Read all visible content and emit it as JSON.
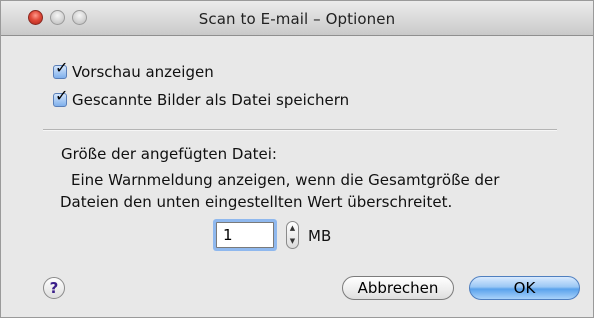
{
  "window": {
    "title": "Scan to E-mail – Optionen"
  },
  "options": {
    "preview": {
      "label": "Vorschau anzeigen",
      "checked": true
    },
    "save_as_file": {
      "label": "Gescannte Bilder als Datei speichern",
      "checked": true
    }
  },
  "attachment": {
    "heading": "Größe der angefügten Datei:",
    "description_line1": "Eine Warnmeldung anzeigen, wenn die Gesamtgröße der",
    "description_line2": "Dateien den unten eingestellten Wert überschreitet.",
    "size_value": "1",
    "unit": "MB"
  },
  "footer": {
    "help_label": "?",
    "cancel_label": "Abbrechen",
    "ok_label": "OK"
  },
  "icons": {
    "checkmark": "✓",
    "stepper_up": "▲",
    "stepper_down": "▼"
  }
}
